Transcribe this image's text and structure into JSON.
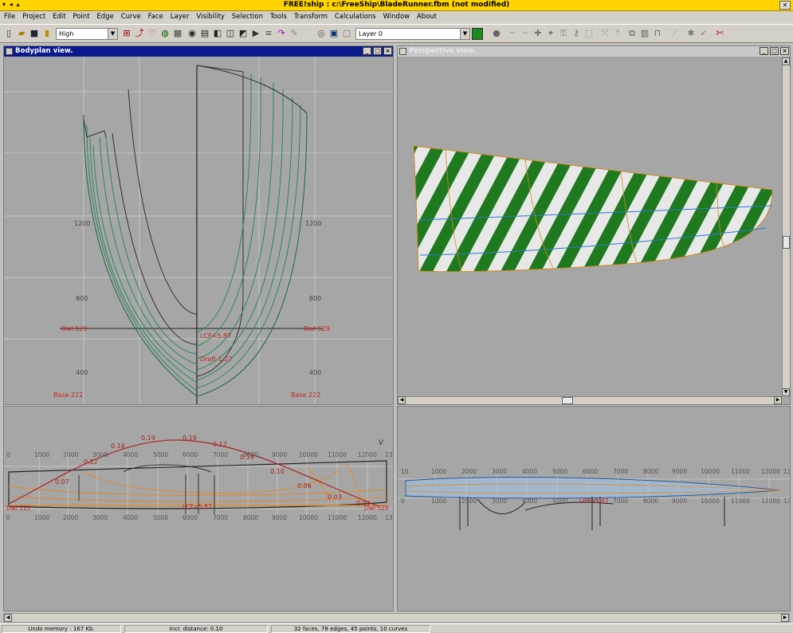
{
  "window": {
    "title": "FREE!ship   : c:\\FreeShip\\BladeRunner.fbm (not modified)",
    "controls_left": "▾ ◂ ▴",
    "close": "✕"
  },
  "menu": [
    "File",
    "Project",
    "Edit",
    "Point",
    "Edge",
    "Curve",
    "Face",
    "Layer",
    "Visibility",
    "Selection",
    "Tools",
    "Transform",
    "Calculations",
    "Window",
    "About"
  ],
  "toolbar": {
    "precision": "High",
    "layer": "Layer 0",
    "layer_color": "#1a8a1a"
  },
  "bodyplan": {
    "title": "Bodyplan view.",
    "labels": {
      "y1200_l": "1200",
      "y1200_r": "1200",
      "y800_l": "800",
      "y800_r": "800",
      "y400_l": "400",
      "y400_r": "400",
      "dwl_l": "Dwl 529",
      "dwl_r": "Dwl 529",
      "lcf": "LCF=5.87",
      "draft": "Draft 1.27",
      "base_l": "Base 222",
      "base_r": "Base 222"
    }
  },
  "perspective": {
    "title": "Perspective view."
  },
  "profile": {
    "ticks_top": [
      "0",
      "1000",
      "2000",
      "3000",
      "4000",
      "5000",
      "6000",
      "7000",
      "8000",
      "9000",
      "10000",
      "11000",
      "12000",
      "13"
    ],
    "ticks_bottom": [
      "0",
      "1000",
      "2000",
      "3000",
      "4000",
      "5000",
      "6000",
      "7000",
      "8000",
      "9000",
      "10000",
      "11000",
      "12000",
      "13"
    ],
    "curve_labels": [
      "0.07",
      "0.12",
      "0.16",
      "0.19",
      "0.19",
      "0.17",
      "0.14",
      "0.10",
      "0.06",
      "0.03",
      "0.01"
    ],
    "left_mark": "Dwl 222",
    "right_mark": "Dwl 529",
    "mid_mark": "LCF=5.87",
    "corner_mark": "V"
  },
  "plan": {
    "ticks_top": [
      "10",
      "1000",
      "2000",
      "3000",
      "4000",
      "5000",
      "6000",
      "7000",
      "8000",
      "9000",
      "10000",
      "11000",
      "12000",
      "13"
    ],
    "ticks_bottom": [
      "0",
      "1000",
      "2000",
      "3000",
      "4000",
      "5000",
      "6000",
      "7000",
      "8000",
      "9000",
      "10000",
      "11000",
      "12000",
      "13"
    ],
    "mid_mark": "LCF=5.87"
  },
  "status": {
    "undo": "Undo memory : 167 Kb.",
    "distance": "Incr. distance: 0.10",
    "model": "32 faces, 78 edges, 45 points, 10 curves"
  }
}
